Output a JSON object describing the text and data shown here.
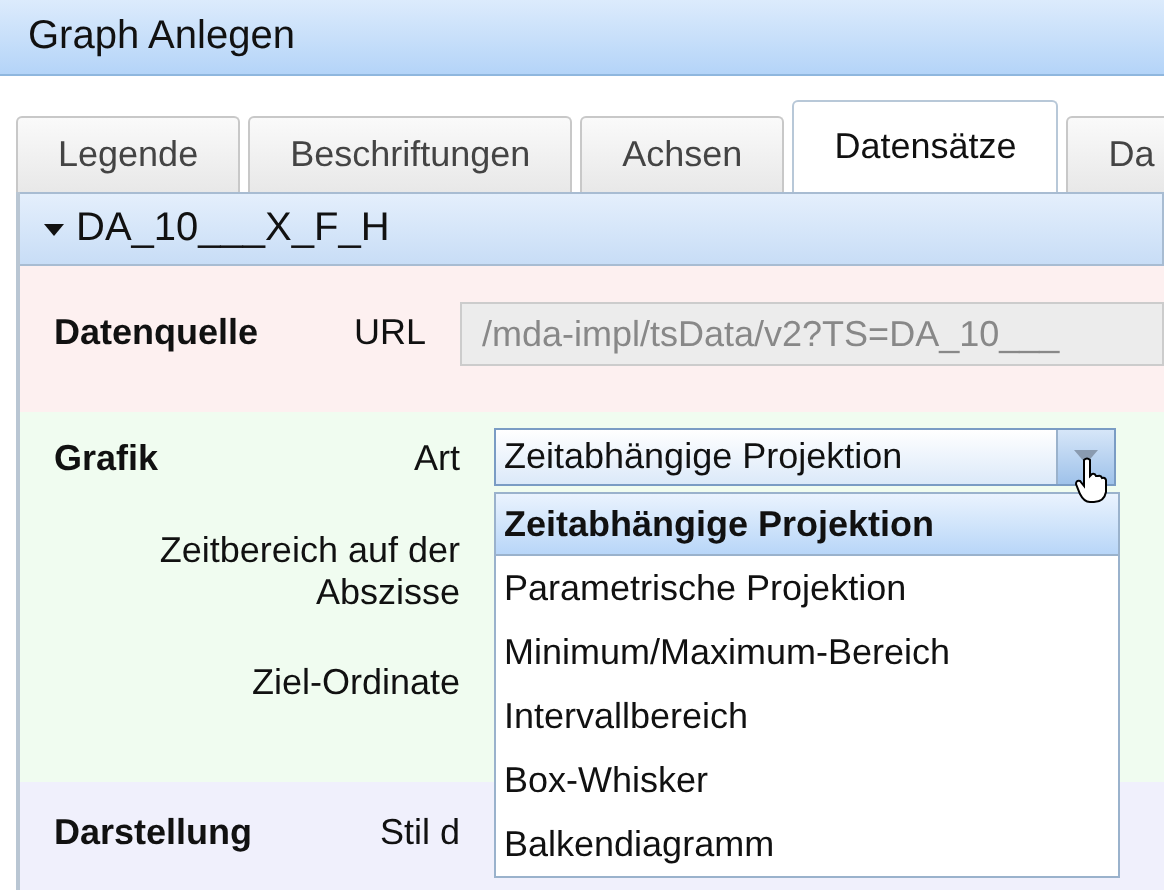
{
  "window": {
    "title": "Graph Anlegen"
  },
  "tabs": [
    {
      "label": "Legende",
      "selected": false
    },
    {
      "label": "Beschriftungen",
      "selected": false
    },
    {
      "label": "Achsen",
      "selected": false
    },
    {
      "label": "Datensätze",
      "selected": true
    },
    {
      "label": "Da",
      "selected": false
    }
  ],
  "dataset": {
    "name": "DA_10___X_F_H",
    "expanded": true
  },
  "sections": [
    {
      "kind": "source",
      "title": "Datenquelle",
      "rows": [
        {
          "label": "URL",
          "kind": "text",
          "value": "/mda-impl/tsData/v2?TS=DA_10___",
          "disabled": true
        }
      ]
    },
    {
      "kind": "graphic",
      "title": "Grafik",
      "rows": [
        {
          "label": "Art",
          "kind": "select",
          "value": "Zeitabhängige Projektion",
          "open": true,
          "options": [
            {
              "label": "Zeitabhängige Projektion",
              "selected": true
            },
            {
              "label": "Parametrische Projektion",
              "selected": false
            },
            {
              "label": "Minimum/Maximum-Bereich",
              "selected": false
            },
            {
              "label": "Intervallbereich",
              "selected": false
            },
            {
              "label": "Box-Whisker",
              "selected": false
            },
            {
              "label": "Balkendiagramm",
              "selected": false
            }
          ]
        },
        {
          "label": "Zeitbereich auf der Abszisse",
          "kind": "hidden"
        },
        {
          "label": "Ziel-Ordinate",
          "kind": "hidden"
        }
      ]
    },
    {
      "kind": "display",
      "title": "Darstellung",
      "rows": [
        {
          "label": "Stil d",
          "kind": "hidden"
        }
      ]
    }
  ]
}
